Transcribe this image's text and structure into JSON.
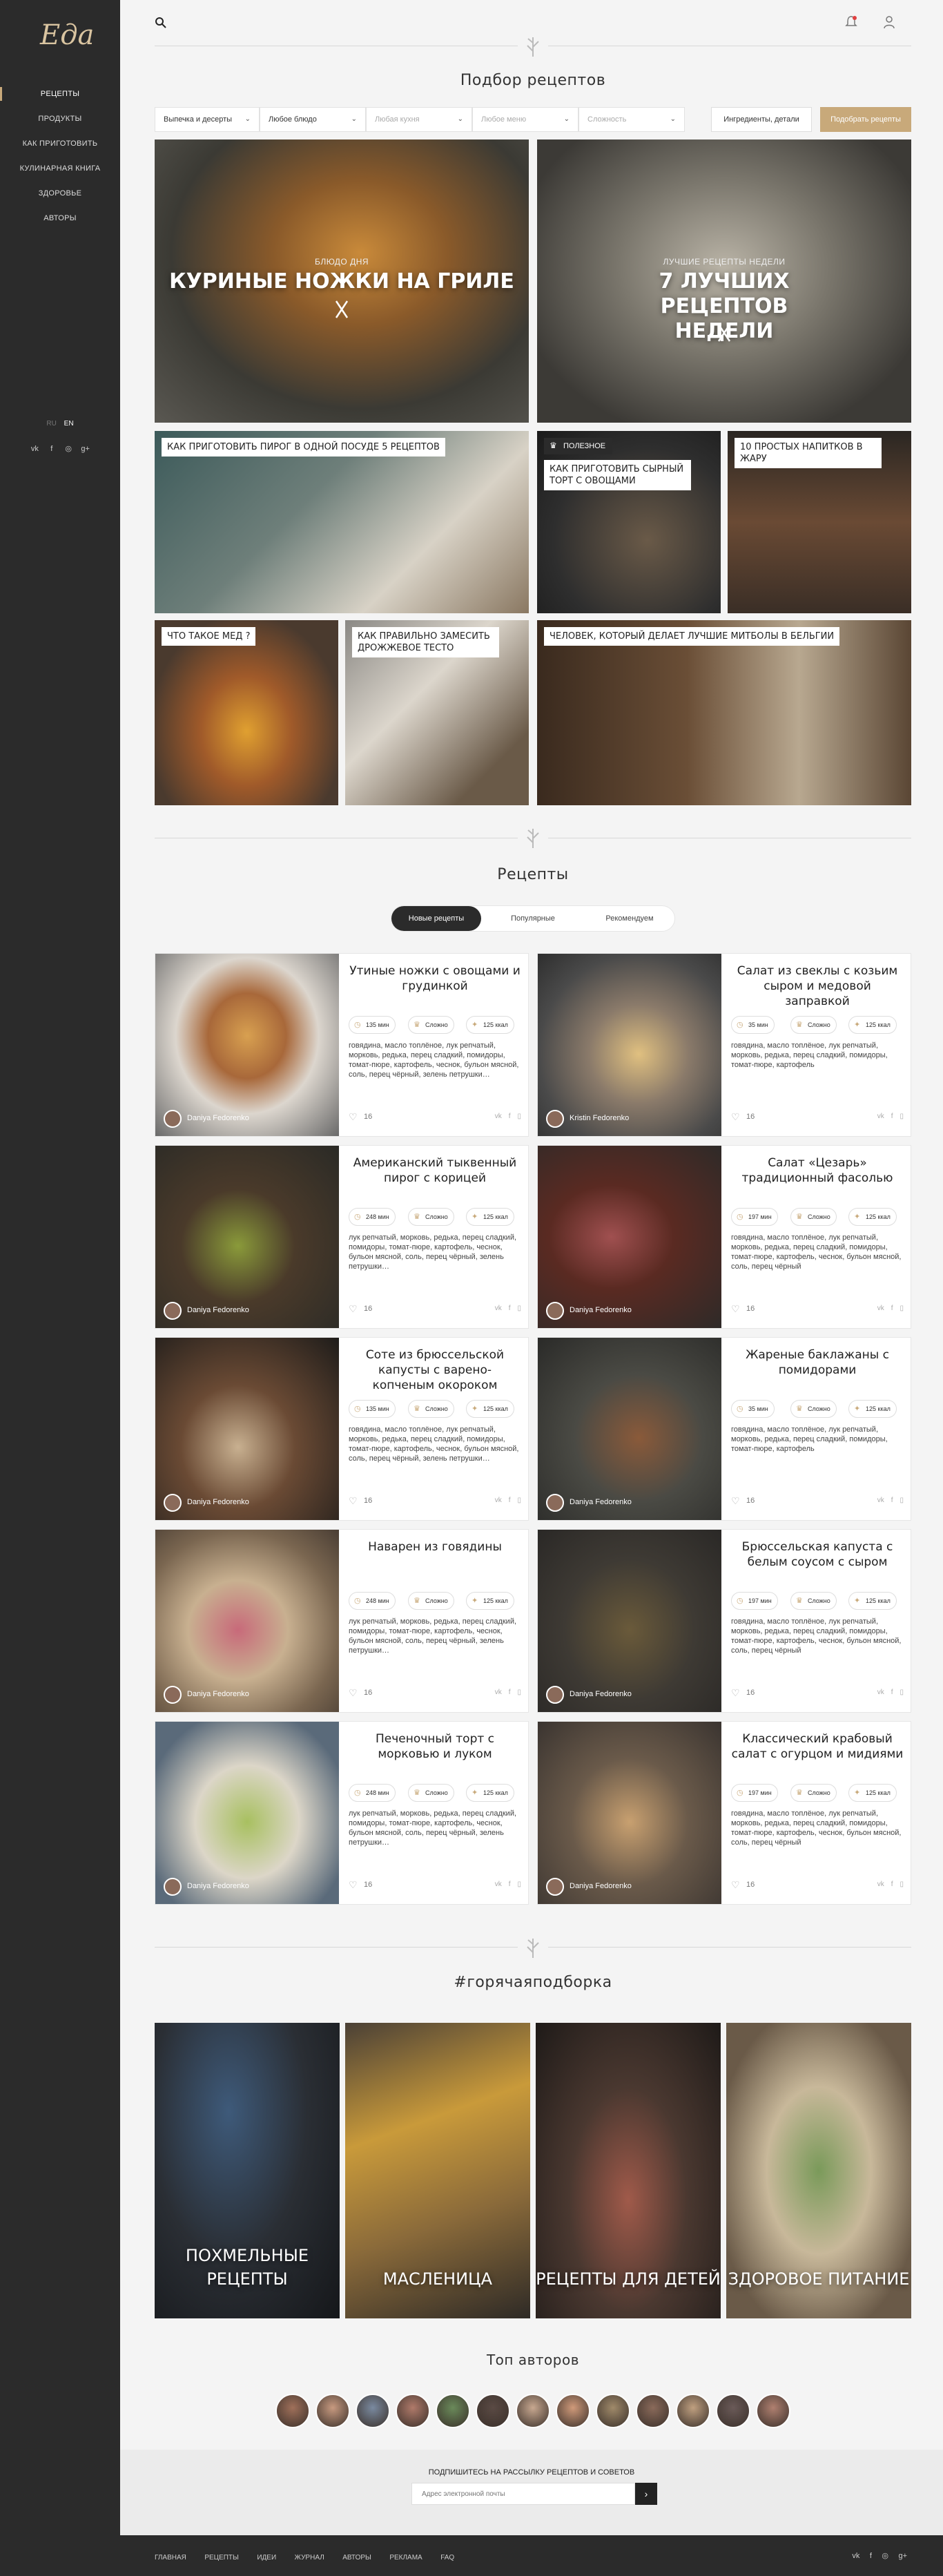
{
  "app": {
    "logo": "Еда"
  },
  "sidebar": {
    "items": [
      {
        "label": "Рецепты"
      },
      {
        "label": "Продукты"
      },
      {
        "label": "Как приготовить"
      },
      {
        "label": "Кулинарная книга"
      },
      {
        "label": "Здоровье"
      },
      {
        "label": "Авторы"
      }
    ],
    "lang": {
      "ru": "RU",
      "en": "EN"
    },
    "social": [
      "vk",
      "f",
      "ig",
      "g+"
    ]
  },
  "header": {
    "search_icon": "search-icon",
    "bell_icon": "bell-icon",
    "user_icon": "user-icon"
  },
  "selection": {
    "title": "Подбор рецептов",
    "filters": [
      {
        "value": "Выпечка и десерты"
      },
      {
        "value": "Любое блюдо"
      },
      {
        "value": "Любая кухня"
      },
      {
        "value": "Любое меню"
      },
      {
        "value": "Сложность"
      }
    ],
    "ingredients_button": "Ингредиенты, детали",
    "pick_button": "Подобрать рецепты"
  },
  "featured": {
    "hero1": {
      "subtitle": "Блюдо дня",
      "title": "Куриные ножки на гриле"
    },
    "hero2": {
      "subtitle": "Лучшие рецепты недели",
      "title": "7 лучших рецептов недели"
    },
    "tiles": [
      {
        "label": "Как приготовить пирог в одной посуде 5 рецептов"
      },
      {
        "badge": "Полезное",
        "label": "Как приготовить сырный торт с овощами"
      },
      {
        "label": "10 простых напитков в жару"
      },
      {
        "label": "Что такое мед ?"
      },
      {
        "label": "Как правильно замесить дрожжевое тесто"
      },
      {
        "label": "Человек, который делает лучшие митболы в Бельгии"
      }
    ]
  },
  "recipes": {
    "title": "Рецепты",
    "tabs": [
      "Новые рецепты",
      "Популярные",
      "Рекомендуем"
    ],
    "cards": [
      {
        "title": "Утиные ножки с овощами и грудинкой",
        "time": "135 мин",
        "difficulty": "Сложно",
        "kcal": "125 ккал",
        "ingredients": "говядина, масло топлёное, лук репчатый, морковь, редька, перец сладкий, помидоры, томат-пюре, картофель, чеснок, бульон мясной, соль, перец чёрный, зелень петрушки…",
        "author": "Daniya Fedorenko",
        "likes": "16"
      },
      {
        "title": "Салат из свеклы с козьим сыром и медовой заправкой",
        "time": "35 мин",
        "difficulty": "Сложно",
        "kcal": "125 ккал",
        "ingredients": "говядина, масло топлёное, лук репчатый, морковь, редька, перец сладкий, помидоры, томат-пюре, картофель",
        "author": "Kristin Fedorenko",
        "likes": "16"
      },
      {
        "title": "Американский тыквенный пирог с корицей",
        "time": "248 мин",
        "difficulty": "Сложно",
        "kcal": "125 ккал",
        "ingredients": "лук репчатый, морковь, редька, перец сладкий, помидоры, томат-пюре, картофель, чеснок, бульон мясной, соль, перец чёрный, зелень петрушки…",
        "author": "Daniya Fedorenko",
        "likes": "16"
      },
      {
        "title": "Салат «Цезарь» традиционный фасолью",
        "time": "197 мин",
        "difficulty": "Сложно",
        "kcal": "125 ккал",
        "ingredients": "говядина, масло топлёное, лук репчатый, морковь, редька, перец сладкий, помидоры, томат-пюре, картофель, чеснок, бульон мясной, соль, перец чёрный",
        "author": "Daniya Fedorenko",
        "likes": "16"
      },
      {
        "title": "Соте из брюссельской капусты с варено-копченым окороком",
        "time": "135 мин",
        "difficulty": "Сложно",
        "kcal": "125 ккал",
        "ingredients": "говядина, масло топлёное, лук репчатый, морковь, редька, перец сладкий, помидоры, томат-пюре, картофель, чеснок, бульон мясной, соль, перец чёрный, зелень петрушки…",
        "author": "Daniya Fedorenko",
        "likes": "16"
      },
      {
        "title": "Жареные баклажаны с помидорами",
        "time": "35 мин",
        "difficulty": "Сложно",
        "kcal": "125 ккал",
        "ingredients": "говядина, масло топлёное, лук репчатый, морковь, редька, перец сладкий, помидоры, томат-пюре, картофель",
        "author": "Daniya Fedorenko",
        "likes": "16"
      },
      {
        "title": "Наварен из говядины",
        "time": "248 мин",
        "difficulty": "Сложно",
        "kcal": "125 ккал",
        "ingredients": "лук репчатый, морковь, редька, перец сладкий, помидоры, томат-пюре, картофель, чеснок, бульон мясной, соль, перец чёрный, зелень петрушки…",
        "author": "Daniya Fedorenko",
        "likes": "16"
      },
      {
        "title": "Брюссельская капуста с белым соусом с сыром",
        "time": "197 мин",
        "difficulty": "Сложно",
        "kcal": "125 ккал",
        "ingredients": "говядина, масло топлёное, лук репчатый, морковь, редька, перец сладкий, помидоры, томат-пюре, картофель, чеснок, бульон мясной, соль, перец чёрный",
        "author": "Daniya Fedorenko",
        "likes": "16"
      },
      {
        "title": "Печеночный торт с морковью и луком",
        "time": "248 мин",
        "difficulty": "Сложно",
        "kcal": "125 ккал",
        "ingredients": "лук репчатый, морковь, редька, перец сладкий, помидоры, томат-пюре, картофель, чеснок, бульон мясной, соль, перец чёрный, зелень петрушки…",
        "author": "Daniya Fedorenko",
        "likes": "16"
      },
      {
        "title": "Классический крабовый салат с огурцом и мидиями",
        "time": "197 мин",
        "difficulty": "Сложно",
        "kcal": "125 ккал",
        "ingredients": "говядина, масло топлёное, лук репчатый, морковь, редька, перец сладкий, помидоры, томат-пюре, картофель, чеснок, бульон мясной, соль, перец чёрный",
        "author": "Daniya Fedorenko",
        "likes": "16"
      }
    ]
  },
  "hot": {
    "title": "#горячаяподборка",
    "tiles": [
      {
        "title": "Похмельные рецепты"
      },
      {
        "title": "Масленица"
      },
      {
        "title": "Рецепты для детей"
      },
      {
        "title": "Здоровое питание"
      }
    ]
  },
  "top_authors": {
    "title": "Топ авторов",
    "count": 13
  },
  "subscribe": {
    "title": "Подпишитесь на рассылку рецептов и советов",
    "placeholder": "Адрес электронной почты",
    "button_icon": "arrow-right-icon"
  },
  "footer": {
    "nav": [
      "Главная",
      "Рецепты",
      "Идеи",
      "Журнал",
      "Авторы",
      "Реклама",
      "FAQ"
    ],
    "social": [
      "vk",
      "f",
      "ig",
      "g+"
    ]
  },
  "colors": {
    "accent": "#c8a97a",
    "sidebar": "#2b2b2b",
    "background": "#f4f4f4"
  }
}
